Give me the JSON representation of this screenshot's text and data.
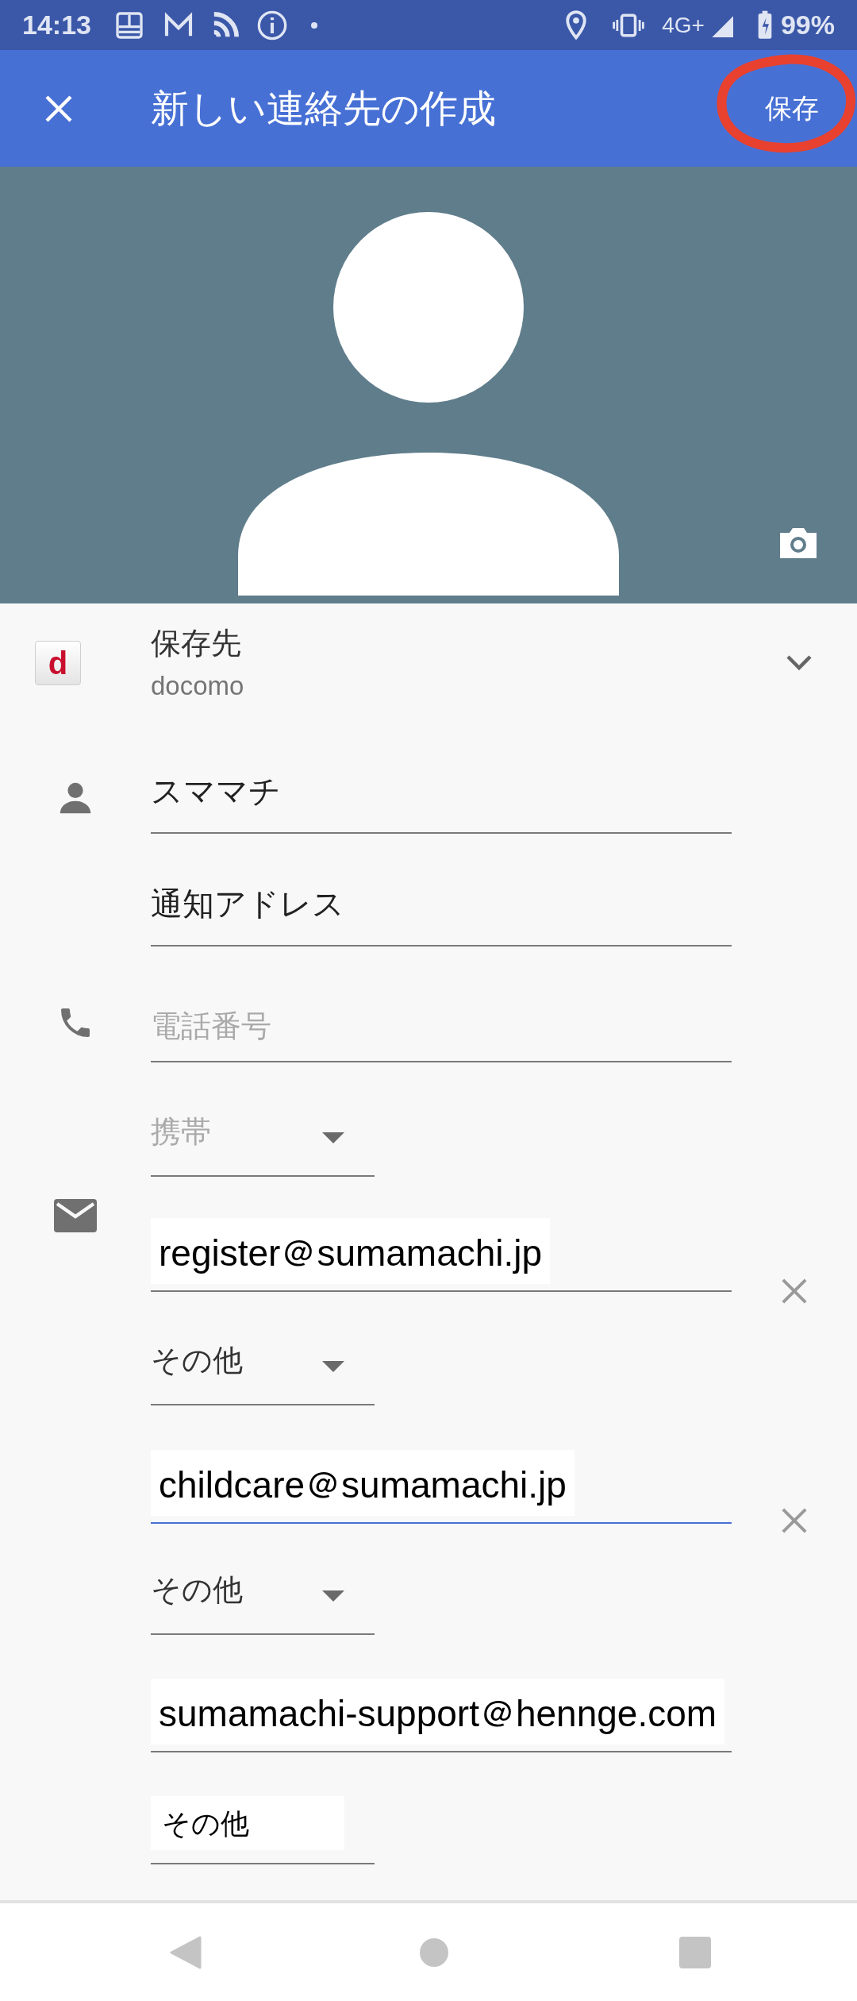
{
  "status_bar": {
    "time": "14:13",
    "network": "4G+",
    "battery": "99%"
  },
  "toolbar": {
    "title": "新しい連絡先の作成",
    "save": "保存"
  },
  "account": {
    "label": "保存先",
    "value": "docomo",
    "logo": "d"
  },
  "name_fields": [
    {
      "value": "スママチ"
    },
    {
      "value": "通知アドレス"
    }
  ],
  "phone": {
    "number": {
      "placeholder": "電話番号"
    },
    "type": {
      "value": "携帯",
      "disabled": true
    }
  },
  "emails": [
    {
      "address": "register＠sumamachi.jp",
      "focused": false,
      "removable": true,
      "type": "その他",
      "dropdown": true
    },
    {
      "address": "childcare＠sumamachi.jp",
      "focused": true,
      "removable": true,
      "type": "その他",
      "dropdown": true
    },
    {
      "address": "sumamachi-support＠hennge.com",
      "focused": false,
      "removable": false,
      "type": "その他",
      "dropdown": false
    }
  ]
}
